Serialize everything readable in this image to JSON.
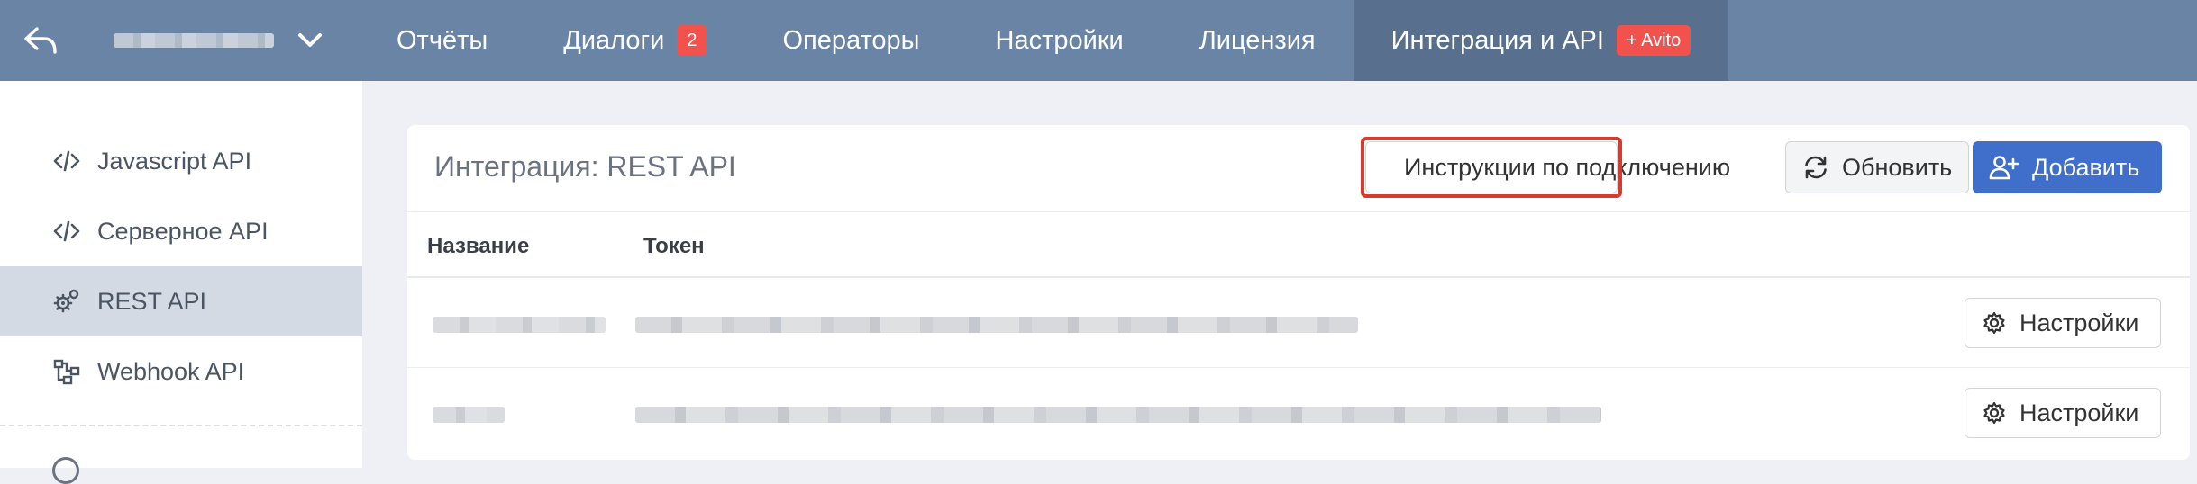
{
  "topbar": {
    "back_icon": "reply-arrow-icon",
    "account_icon": "chevron-down-icon",
    "nav": [
      {
        "label": "Отчёты"
      },
      {
        "label": "Диалоги",
        "badge": "2"
      },
      {
        "label": "Операторы"
      },
      {
        "label": "Настройки"
      },
      {
        "label": "Лицензия"
      },
      {
        "label": "Интеграция и API",
        "badge": "+ Avito",
        "active": true
      }
    ]
  },
  "sidebar": {
    "items": [
      {
        "label": "Javascript API",
        "icon": "code-icon"
      },
      {
        "label": "Серверное API",
        "icon": "code-icon"
      },
      {
        "label": "REST API",
        "icon": "gears-icon",
        "active": true
      },
      {
        "label": "Webhook API",
        "icon": "webhook-icon"
      }
    ]
  },
  "card": {
    "title": "Интеграция: REST API",
    "instructions_label": "Инструкции по подключению",
    "refresh_label": "Обновить",
    "add_label": "Добавить",
    "columns": [
      "Название",
      "Токен"
    ],
    "row_action_label": "Настройки"
  },
  "colors": {
    "topbar": "#6a84a5",
    "topbar_active": "#586f8d",
    "badge": "#f1524e",
    "primary": "#3f6ecb",
    "highlight": "#d63b30"
  }
}
